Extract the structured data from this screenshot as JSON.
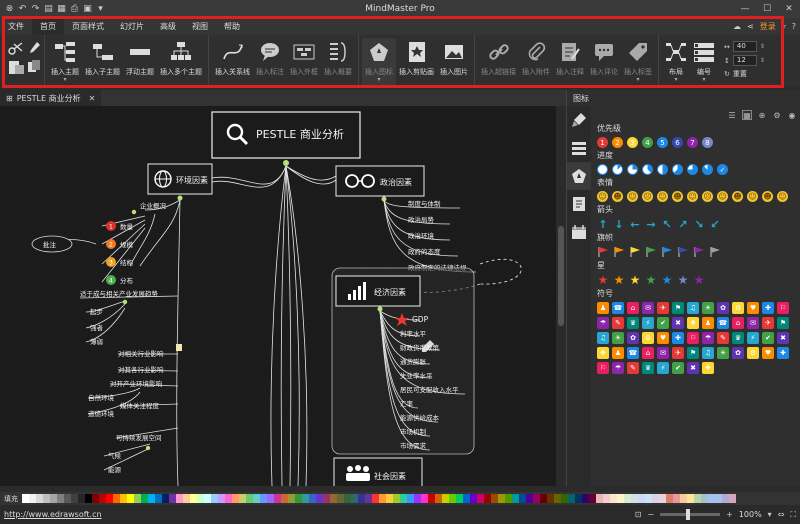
{
  "window": {
    "title": "MindMaster Pro"
  },
  "menu": {
    "items": [
      {
        "label": "文件"
      },
      {
        "label": "首页",
        "active": true
      },
      {
        "label": "页面样式"
      },
      {
        "label": "幻灯片"
      },
      {
        "label": "高级"
      },
      {
        "label": "视图"
      },
      {
        "label": "帮助"
      }
    ],
    "login": "登录"
  },
  "ribbon": {
    "insert_topic": "插入主题",
    "insert_subtopic": "插入子主题",
    "float_topic": "浮动主题",
    "insert_multi": "插入多个主题",
    "insert_relation": "插入关系线",
    "insert_callout": "插入标注",
    "insert_boundary": "插入外框",
    "insert_summary": "插入概要",
    "insert_icon": "插入图标",
    "insert_clipart": "插入剪贴画",
    "insert_image": "插入图片",
    "insert_hyperlink": "插入超链接",
    "insert_attachment": "插入附件",
    "insert_note": "插入注释",
    "insert_comment": "插入评论",
    "insert_tag": "插入标签",
    "layout": "布局",
    "numbering": "编号",
    "spin1": "40",
    "spin2": "12",
    "reset": "重置"
  },
  "document": {
    "tab": "PESTLE 商业分析"
  },
  "mindmap": {
    "central": "PESTLE 商业分析",
    "env": {
      "title": "环境因素",
      "overview": "企业概况",
      "numbered": [
        {
          "num": "1",
          "text": "数量",
          "color": "#d9302c"
        },
        {
          "num": "2",
          "text": "规模",
          "color": "#f07a22"
        },
        {
          "num": "3",
          "text": "结构",
          "color": "#f0a020"
        },
        {
          "num": "4",
          "text": "分布",
          "color": "#4caf50"
        }
      ],
      "impact": "适于成与相关产业发展趋势",
      "sub": [
        "起步",
        "强者",
        "薄弱"
      ],
      "lines": [
        "对相关行业影响",
        "对其各行业影响",
        "对开产业环境影响"
      ],
      "nature": "自然环境",
      "weather": "道德环境",
      "right_list": [
        "媒体关注程度",
        "可持续发展空间"
      ],
      "bottom": [
        "气候",
        "能源"
      ]
    },
    "politics": {
      "title": "政治因素",
      "items": [
        "制度与体制",
        "政治局势",
        "政治环境",
        "政府的态度",
        "政府制定的法律法规"
      ]
    },
    "economy": {
      "title": "经济因素",
      "items": [
        "GDP",
        "利率水平",
        "财政货币政策",
        "通货膨胀",
        "失业率水平",
        "居民可支配收入水平",
        "汇率",
        "能源供给成本",
        "市场机制",
        "市场需求"
      ]
    },
    "social": {
      "title": "社会因素"
    },
    "note": "批注"
  },
  "panel": {
    "title": "图标",
    "sections": {
      "priority": "优先级",
      "progress": "进度",
      "emoji": "表情",
      "arrow": "箭头",
      "flag": "旗帜",
      "star": "星",
      "symbol": "符号"
    },
    "priority_nums": [
      "1",
      "2",
      "3",
      "4",
      "5",
      "6",
      "7",
      "8"
    ],
    "priority_colors": [
      "#e53935",
      "#fb8c00",
      "#fdd835",
      "#43a047",
      "#1e88e5",
      "#3949ab",
      "#8e24aa",
      "#7986cb"
    ],
    "flag_colors": [
      "#e53935",
      "#fb8c00",
      "#fdd835",
      "#43a047",
      "#1e88e5",
      "#3949ab",
      "#8e24aa",
      "#9e9e9e"
    ],
    "star_colors": [
      "#e53935",
      "#fb8c00",
      "#fdd835",
      "#43a047",
      "#1e88e5",
      "#7986cb",
      "#8e24aa"
    ]
  },
  "palette": {
    "label": "填充"
  },
  "status": {
    "url": "http://www.edrawsoft.cn",
    "zoom": "100%"
  }
}
